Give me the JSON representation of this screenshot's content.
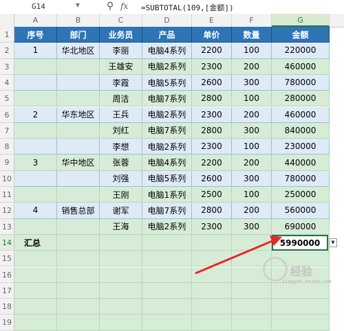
{
  "formula_bar": {
    "name_box": "G14",
    "formula": "=SUBTOTAL(109,[金额])",
    "zoom_icon": "magnifier-icon",
    "fx_icon": "fx-icon"
  },
  "columns": [
    "A",
    "B",
    "C",
    "D",
    "E",
    "F",
    "G"
  ],
  "selected_column": "G",
  "rows": [
    "1",
    "2",
    "3",
    "4",
    "5",
    "6",
    "7",
    "8",
    "9",
    "10",
    "11",
    "12",
    "13",
    "14",
    "15",
    "16",
    "17",
    "18",
    "19"
  ],
  "selected_row": "14",
  "table": {
    "headers": [
      "序号",
      "部门",
      "业务员",
      "产品",
      "单价",
      "数量",
      "金额"
    ],
    "records": [
      {
        "no": "1",
        "dept": "华北地区",
        "person": "李丽",
        "product": "电脑4系列",
        "price": "2200",
        "qty": "100",
        "amount": "220000"
      },
      {
        "no": "",
        "dept": "",
        "person": "王雄安",
        "product": "电脑2系列",
        "price": "2300",
        "qty": "200",
        "amount": "460000"
      },
      {
        "no": "",
        "dept": "",
        "person": "李霞",
        "product": "电脑5系列",
        "price": "2600",
        "qty": "300",
        "amount": "780000"
      },
      {
        "no": "",
        "dept": "",
        "person": "周洁",
        "product": "电脑7系列",
        "price": "2800",
        "qty": "100",
        "amount": "280000"
      },
      {
        "no": "2",
        "dept": "华东地区",
        "person": "王兵",
        "product": "电脑2系列",
        "price": "2300",
        "qty": "200",
        "amount": "460000"
      },
      {
        "no": "",
        "dept": "",
        "person": "刘红",
        "product": "电脑7系列",
        "price": "2800",
        "qty": "300",
        "amount": "840000"
      },
      {
        "no": "",
        "dept": "",
        "person": "李想",
        "product": "电脑2系列",
        "price": "2300",
        "qty": "100",
        "amount": "230000"
      },
      {
        "no": "3",
        "dept": "华中地区",
        "person": "张蓉",
        "product": "电脑4系列",
        "price": "2200",
        "qty": "200",
        "amount": "440000"
      },
      {
        "no": "",
        "dept": "",
        "person": "刘强",
        "product": "电脑5系列",
        "price": "2600",
        "qty": "300",
        "amount": "780000"
      },
      {
        "no": "",
        "dept": "",
        "person": "王刚",
        "product": "电脑1系列",
        "price": "2500",
        "qty": "100",
        "amount": "250000"
      },
      {
        "no": "4",
        "dept": "销售总部",
        "person": "谢军",
        "product": "电脑7系列",
        "price": "2800",
        "qty": "200",
        "amount": "560000"
      },
      {
        "no": "",
        "dept": "",
        "person": "王海",
        "product": "电脑2系列",
        "price": "2300",
        "qty": "300",
        "amount": "690000"
      }
    ],
    "total_label": "汇总",
    "total_amount": "5990000"
  },
  "colors": {
    "header_bg": "#2e75b6",
    "band_blue": "#deebf7",
    "band_green": "#d6ecd6",
    "selection": "#217346",
    "arrow": "#e8262b"
  },
  "watermark": {
    "text": "经验",
    "url": "jingyan.baidu.com"
  }
}
